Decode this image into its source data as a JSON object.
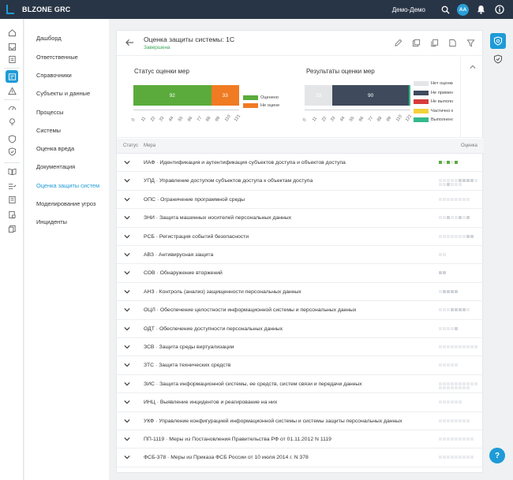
{
  "app": {
    "name": "BLZONE GRC",
    "user_name": "Демо-Демо",
    "avatar_initials": "АА",
    "accent_color": "#1e9bd7",
    "topbar_color": "#283546"
  },
  "topbar_icons": [
    "search-icon",
    "bell-icon",
    "info-icon"
  ],
  "nav": {
    "items": [
      {
        "label": "Дашборд"
      },
      {
        "label": "Ответственные"
      },
      {
        "label": "Справочники"
      },
      {
        "label": "Субъекты и данные"
      },
      {
        "label": "Процессы"
      },
      {
        "label": "Системы"
      },
      {
        "label": "Оценка вреда"
      },
      {
        "label": "Документация"
      },
      {
        "label": "Оценка защиты систем",
        "active": true
      },
      {
        "label": "Моделирование угроз"
      },
      {
        "label": "Инциденты"
      }
    ]
  },
  "header": {
    "title": "Оценка защиты системы: 1С",
    "status": "Завершена",
    "actions": [
      "edit-icon",
      "compare-icon",
      "copy-icon",
      "document-icon",
      "filter-icon"
    ]
  },
  "chart_data": [
    {
      "type": "bar",
      "title": "Статус оценки мер",
      "stacked": true,
      "orientation": "horizontal",
      "x_ticks": [
        "0",
        "11",
        "22",
        "33",
        "44",
        "55",
        "66",
        "77",
        "88",
        "99",
        "110",
        "121"
      ],
      "xlim": [
        0,
        125
      ],
      "series": [
        {
          "name": "Оценено",
          "value": 92,
          "color": "#5aab3c"
        },
        {
          "name": "Не оценено",
          "value": 33,
          "color": "#f07b22"
        }
      ],
      "legend_position": "right"
    },
    {
      "type": "bar",
      "title": "Результаты оценки мер",
      "stacked": true,
      "orientation": "horizontal",
      "x_ticks": [
        "0",
        "11",
        "22",
        "33",
        "44",
        "55",
        "66",
        "77",
        "88",
        "99",
        "110",
        "121"
      ],
      "xlim": [
        0,
        125
      ],
      "series": [
        {
          "name": "Нет оценки",
          "value": 33,
          "color": "#e4e5e7"
        },
        {
          "name": "Не применимо",
          "value": 90,
          "color": "#3f4a5c"
        },
        {
          "name": "Не выполнено",
          "value": 0,
          "color": "#d63b3b"
        },
        {
          "name": "Частично выполнено",
          "value": 0,
          "color": "#f2d03b"
        },
        {
          "name": "Выполнено",
          "value": 2,
          "color": "#34b98a"
        }
      ],
      "legend_position": "right"
    }
  ],
  "table": {
    "status_header": "Статус",
    "measure_header": "Мера",
    "score_header": "Оценка",
    "rows": [
      {
        "code": "ИАФ",
        "name": "Идентификация и аутентификация субъектов доступа и объектов доступа",
        "score": [
          "g",
          "w",
          "g",
          "w",
          "g"
        ]
      },
      {
        "code": "УПД",
        "name": "Управление доступом субъектов доступа к объектам доступа",
        "score": [
          "w",
          "w",
          "w",
          "w",
          "w",
          "l",
          "l",
          "l",
          "l",
          "w",
          "w",
          "w",
          "l",
          "w",
          "w",
          "w"
        ]
      },
      {
        "code": "ОПС",
        "name": "Ограничение программной среды",
        "score": [
          "w",
          "w",
          "w",
          "w",
          "w",
          "w",
          "w",
          "w"
        ]
      },
      {
        "code": "ЗНИ",
        "name": "Защита машинных носителей персональных данных",
        "score": [
          "w",
          "w",
          "l",
          "w",
          "w",
          "l",
          "w",
          "l"
        ]
      },
      {
        "code": "РСБ",
        "name": "Регистрация событий безопасности",
        "score": [
          "w",
          "w",
          "w",
          "w",
          "w",
          "w",
          "w",
          "l",
          "l"
        ]
      },
      {
        "code": "АВЗ",
        "name": "Антивирусная защита",
        "score": [
          "w",
          "w"
        ]
      },
      {
        "code": "СОВ",
        "name": "Обнаружение вторжений",
        "score": [
          "l",
          "l"
        ]
      },
      {
        "code": "АНЗ",
        "name": "Контроль (анализ) защищенности персональных данных",
        "score": [
          "w",
          "l",
          "l",
          "l",
          "l"
        ]
      },
      {
        "code": "ОЦЛ",
        "name": "Обеспечение целостности информационной системы и персональных данных",
        "score": [
          "w",
          "w",
          "w",
          "l",
          "l",
          "l",
          "l",
          "w"
        ]
      },
      {
        "code": "ОДТ",
        "name": "Обеспечение доступности персональных данных",
        "score": [
          "w",
          "w",
          "w",
          "w",
          "l"
        ]
      },
      {
        "code": "ЗСВ",
        "name": "Защита среды виртуализации",
        "score": [
          "w",
          "w",
          "w",
          "w",
          "w",
          "w",
          "w",
          "w",
          "w",
          "w"
        ]
      },
      {
        "code": "ЗТС",
        "name": "Защита технических средств",
        "score": [
          "w",
          "w",
          "w",
          "w",
          "w"
        ]
      },
      {
        "code": "ЗИС",
        "name": "Защита информационной системы, ее средств, систем связи и передачи данных",
        "score": [
          "w",
          "w",
          "w",
          "w",
          "w",
          "w",
          "w",
          "w",
          "w",
          "w",
          "w",
          "w",
          "w",
          "w",
          "w",
          "w",
          "w",
          "w"
        ]
      },
      {
        "code": "ИНЦ",
        "name": "Выявление инцидентов и реагирование на них",
        "score": [
          "w",
          "w",
          "w",
          "w",
          "w",
          "w"
        ]
      },
      {
        "code": "УКФ",
        "name": "Управление конфигурацией информационной системы и системы защиты персональных данных",
        "score": [
          "w",
          "w",
          "w",
          "w",
          "w",
          "w",
          "w",
          "w"
        ]
      },
      {
        "code": "ПП-1119",
        "name": "Меры из Постановления Правительства РФ от 01.11.2012 N 1119",
        "score": [
          "w",
          "w",
          "w",
          "w",
          "w",
          "w",
          "w",
          "w",
          "w"
        ]
      },
      {
        "code": "ФСБ-378",
        "name": "Меры из Приказа ФСБ России от 10 июля 2014 г. N 378",
        "score": [
          "w",
          "w",
          "w",
          "w",
          "w",
          "w",
          "w",
          "w",
          "w"
        ]
      }
    ]
  },
  "score_colors": {
    "g": "#5aab3c",
    "l": "#cfd3d8",
    "w": "#e9ebee"
  },
  "help_label": "?"
}
